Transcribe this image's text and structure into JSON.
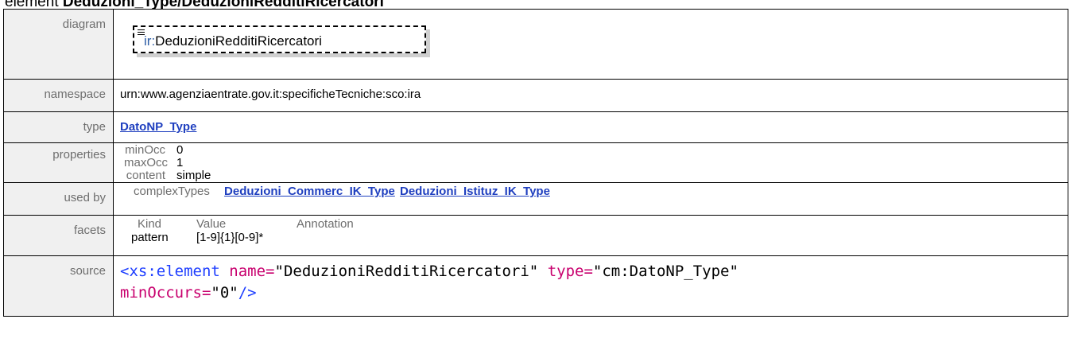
{
  "heading": {
    "prefix": "element ",
    "name": "Deduzioni_Type/DeduzioniRedditiRicercatori"
  },
  "rows": {
    "diagram": {
      "label": "diagram",
      "prefix": "ir:",
      "name": "DeduzioniRedditiRicercatori"
    },
    "namespace": {
      "label": "namespace",
      "value": "urn:www.agenziaentrate.gov.it:specificheTecniche:sco:ira"
    },
    "type": {
      "label": "type",
      "link": "DatoNP_Type"
    },
    "properties": {
      "label": "properties",
      "items": [
        {
          "key": "minOcc",
          "value": "0"
        },
        {
          "key": "maxOcc",
          "value": "1"
        },
        {
          "key": "content",
          "value": "simple"
        }
      ]
    },
    "used_by": {
      "label": "used by",
      "key": "complexTypes",
      "links": [
        "Deduzioni_Commerc_IK_Type",
        "Deduzioni_Istituz_IK_Type"
      ]
    },
    "facets": {
      "label": "facets",
      "headers": [
        "Kind",
        "Value",
        "Annotation"
      ],
      "kind": "pattern",
      "value": "[1-9]{1}[0-9]*"
    },
    "source": {
      "label": "source",
      "open_tag": "<xs:element",
      "attr1_name": "name=",
      "attr1_value": "\"DeduzioniRedditiRicercatori\"",
      "attr2_name": "type=",
      "attr2_value": "\"cm:DatoNP_Type\"",
      "attr3_name": "minOccurs=",
      "attr3_value": "\"0\"",
      "close_tag": "/>"
    }
  }
}
